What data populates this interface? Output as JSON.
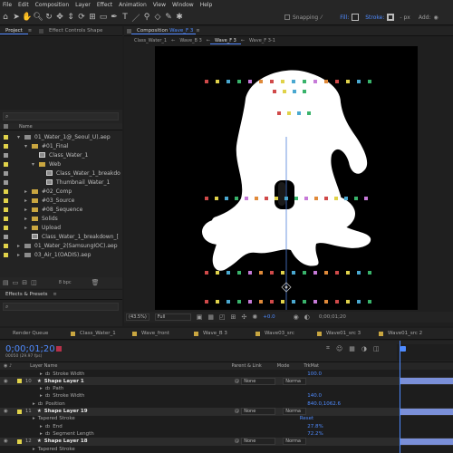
{
  "menu": [
    "File",
    "Edit",
    "Composition",
    "Layer",
    "Effect",
    "Animation",
    "View",
    "Window",
    "Help"
  ],
  "toolbar": {
    "snapping": "Snapping",
    "fill": "Fill:",
    "stroke": "Stroke:",
    "stroke_px": "- px",
    "add": "Add:"
  },
  "project_panel": {
    "tab_project": "Project",
    "tab_effect_controls": "Effect Controls Shape",
    "column_name": "Name",
    "search_placeholder": "",
    "items": [
      {
        "label": "01_Water_1@_Seoul_U).aep",
        "indent": 0,
        "color": "#e0d24a",
        "kind": "file",
        "expanded": true
      },
      {
        "label": "#01_Final",
        "indent": 1,
        "color": "#e0d24a",
        "kind": "folder",
        "expanded": true
      },
      {
        "label": "Class_Water_1",
        "indent": 2,
        "color": "#9a9a9a",
        "kind": "comp",
        "expanded": false
      },
      {
        "label": "Web",
        "indent": 2,
        "color": "#e0d24a",
        "kind": "folder",
        "expanded": true
      },
      {
        "label": "Class_Water_1_breakdo",
        "indent": 3,
        "color": "#9a9a9a",
        "kind": "comp",
        "expanded": false
      },
      {
        "label": "Thumbnail_Water_1",
        "indent": 3,
        "color": "#9a9a9a",
        "kind": "comp",
        "expanded": false
      },
      {
        "label": "#02_Comp",
        "indent": 1,
        "color": "#e0d24a",
        "kind": "folder",
        "expanded": false
      },
      {
        "label": "#03_Source",
        "indent": 1,
        "color": "#e0d24a",
        "kind": "folder",
        "expanded": false
      },
      {
        "label": "#08_Sequence",
        "indent": 1,
        "color": "#e0d24a",
        "kind": "folder",
        "expanded": false
      },
      {
        "label": "Solids",
        "indent": 1,
        "color": "#e0d24a",
        "kind": "folder",
        "expanded": false
      },
      {
        "label": "Upload",
        "indent": 1,
        "color": "#e0d24a",
        "kind": "folder",
        "expanded": false
      },
      {
        "label": "Class_Water_1_breakdown_[",
        "indent": 1,
        "color": "#9a9a9a",
        "kind": "comp",
        "expanded": false
      },
      {
        "label": "01_Water_2(SamsungIOC).aep",
        "indent": 0,
        "color": "#e0d24a",
        "kind": "file",
        "expanded": false
      },
      {
        "label": "03_Air_1(OADIS).aep",
        "indent": 0,
        "color": "#e0d24a",
        "kind": "file",
        "expanded": false
      }
    ],
    "bpc": "8 bpc"
  },
  "effects_presets": {
    "title": "Effects & Presets"
  },
  "composition": {
    "tab_prefix": "Composition",
    "tab_name": "Wave_F 3",
    "sub_tabs": [
      "Class_Water_1",
      "Wave_B 3",
      "Wave_F 3",
      "Wave_F 3-1"
    ],
    "active_sub_tab": 2,
    "zoom": "(43.5%)",
    "resolution": "Full",
    "exposure": "+0.0",
    "timecode": "0;00;01;20"
  },
  "timeline": {
    "tabs": [
      "Render Queue",
      "Class_Water_1",
      "Wave_front",
      "Wave_B 3",
      "Wave03_src",
      "Wave01_src 3",
      "Wave01_src 2"
    ],
    "tab_colors": [
      "#888888",
      "#c9a640",
      "#c9a640",
      "#c9a640",
      "#c9a640",
      "#c9a640",
      "#c9a640"
    ],
    "timecode": "0;00;01;20",
    "frames": "00050 (29.97 fps)",
    "columns": {
      "layer_name": "Layer Name",
      "parent": "Parent & Link",
      "mode": "Mode",
      "trkmat": "TrkMat"
    },
    "rows": [
      {
        "type": "prop",
        "label": "Stroke Width",
        "value": "100.0",
        "indent": 3
      },
      {
        "type": "layer",
        "num": "10",
        "label": "Shape Layer 1",
        "parent": "None",
        "mode": "Norma"
      },
      {
        "type": "prop",
        "label": "Path",
        "value": "",
        "indent": 3
      },
      {
        "type": "prop",
        "label": "Stroke Width",
        "value": "140.0",
        "indent": 3
      },
      {
        "type": "prop",
        "label": "Position",
        "value": "840.0,1062.6",
        "indent": 2
      },
      {
        "type": "layer",
        "num": "11",
        "label": "Shape Layer 19",
        "parent": "None",
        "mode": "Norma"
      },
      {
        "type": "prop",
        "label": "Tapered Stroke",
        "value": "Reset",
        "indent": 2
      },
      {
        "type": "prop",
        "label": "End",
        "value": "27.8%",
        "indent": 3
      },
      {
        "type": "prop",
        "label": "Segment Length",
        "value": "72.2%",
        "indent": 3
      },
      {
        "type": "layer",
        "num": "12",
        "label": "Shape Layer 18",
        "parent": "None",
        "mode": "Norma"
      },
      {
        "type": "prop",
        "label": "Tapered Stroke",
        "value": "",
        "indent": 2
      }
    ]
  },
  "colors": {
    "accent_blue": "#4f8bff",
    "layer_bar": "#7a8fd8",
    "label_yellow": "#e0d24a",
    "layer_label_green": "#39b36b"
  }
}
